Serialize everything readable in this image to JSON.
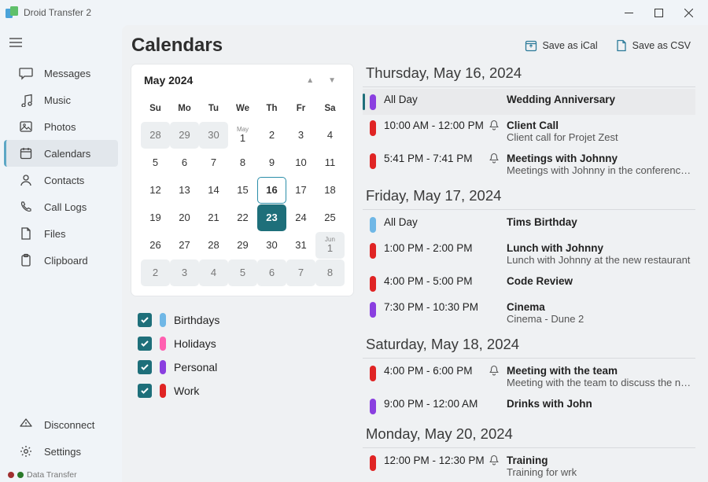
{
  "window": {
    "title": "Droid Transfer 2"
  },
  "sidebar": {
    "items": [
      {
        "label": "Messages"
      },
      {
        "label": "Music"
      },
      {
        "label": "Photos"
      },
      {
        "label": "Calendars"
      },
      {
        "label": "Contacts"
      },
      {
        "label": "Call Logs"
      },
      {
        "label": "Files"
      },
      {
        "label": "Clipboard"
      }
    ],
    "bottom": [
      {
        "label": "Disconnect"
      },
      {
        "label": "Settings"
      }
    ],
    "status": "Data Transfer"
  },
  "header": {
    "title": "Calendars",
    "saveIcal": "Save as iCal",
    "saveCsv": "Save as CSV"
  },
  "miniCal": {
    "title": "May 2024",
    "dow": [
      "Su",
      "Mo",
      "Tu",
      "We",
      "Th",
      "Fr",
      "Sa"
    ],
    "cells": [
      {
        "d": "28",
        "dim": true
      },
      {
        "d": "29",
        "dim": true
      },
      {
        "d": "30",
        "dim": true
      },
      {
        "mo": "May",
        "d": "1"
      },
      {
        "d": "2"
      },
      {
        "d": "3"
      },
      {
        "d": "4"
      },
      {
        "d": "5"
      },
      {
        "d": "6"
      },
      {
        "d": "7"
      },
      {
        "d": "8"
      },
      {
        "d": "9"
      },
      {
        "d": "10"
      },
      {
        "d": "11"
      },
      {
        "d": "12"
      },
      {
        "d": "13"
      },
      {
        "d": "14"
      },
      {
        "d": "15"
      },
      {
        "d": "16",
        "outlined": true
      },
      {
        "d": "17"
      },
      {
        "d": "18"
      },
      {
        "d": "19"
      },
      {
        "d": "20"
      },
      {
        "d": "21"
      },
      {
        "d": "22"
      },
      {
        "d": "23",
        "selected": true
      },
      {
        "d": "24"
      },
      {
        "d": "25"
      },
      {
        "d": "26"
      },
      {
        "d": "27"
      },
      {
        "d": "28"
      },
      {
        "d": "29"
      },
      {
        "d": "30"
      },
      {
        "d": "31"
      },
      {
        "mo": "Jun",
        "d": "1",
        "dim": true
      },
      {
        "d": "2",
        "dim": true
      },
      {
        "d": "3",
        "dim": true
      },
      {
        "d": "4",
        "dim": true
      },
      {
        "d": "5",
        "dim": true
      },
      {
        "d": "6",
        "dim": true
      },
      {
        "d": "7",
        "dim": true
      },
      {
        "d": "8",
        "dim": true
      }
    ]
  },
  "categories": [
    {
      "label": "Birthdays",
      "color": "#6fb7e6"
    },
    {
      "label": "Holidays",
      "color": "#ff5fb0"
    },
    {
      "label": "Personal",
      "color": "#8a3fe0"
    },
    {
      "label": "Work",
      "color": "#e02424"
    }
  ],
  "days": [
    {
      "title": "Thursday, May 16, 2024",
      "events": [
        {
          "color": "#8a3fe0",
          "time": "All Day",
          "bell": false,
          "title": "Wedding Anniversary",
          "desc": "",
          "highlight": true,
          "allday": true
        },
        {
          "color": "#e02424",
          "time": "10:00 AM - 12:00 PM",
          "bell": true,
          "title": "Client Call",
          "desc": "Client call for Projet Zest"
        },
        {
          "color": "#e02424",
          "time": "5:41 PM - 7:41 PM",
          "bell": true,
          "title": "Meetings with Johnny",
          "desc": "Meetings with Johnny in the conference room"
        }
      ]
    },
    {
      "title": "Friday, May 17, 2024",
      "events": [
        {
          "color": "#6fb7e6",
          "time": "All Day",
          "bell": false,
          "title": "Tims Birthday",
          "desc": "",
          "allday": true
        },
        {
          "color": "#e02424",
          "time": "1:00 PM - 2:00 PM",
          "bell": false,
          "title": "Lunch with Johnny",
          "desc": "Lunch with Johnny at the new restaurant"
        },
        {
          "color": "#e02424",
          "time": "4:00 PM - 5:00 PM",
          "bell": false,
          "title": "Code Review",
          "desc": ""
        },
        {
          "color": "#8a3fe0",
          "time": "7:30 PM - 10:30 PM",
          "bell": false,
          "title": "Cinema",
          "desc": "Cinema - Dune 2"
        }
      ]
    },
    {
      "title": "Saturday, May 18, 2024",
      "events": [
        {
          "color": "#e02424",
          "time": "4:00 PM - 6:00 PM",
          "bell": true,
          "title": "Meeting with the team",
          "desc": "Meeting with the team to discuss the new project"
        },
        {
          "color": "#8a3fe0",
          "time": "9:00 PM - 12:00 AM",
          "bell": false,
          "title": "Drinks with John",
          "desc": ""
        }
      ]
    },
    {
      "title": "Monday, May 20, 2024",
      "events": [
        {
          "color": "#e02424",
          "time": "12:00 PM - 12:30 PM",
          "bell": true,
          "title": "Training",
          "desc": "Training for wrk"
        }
      ]
    }
  ]
}
